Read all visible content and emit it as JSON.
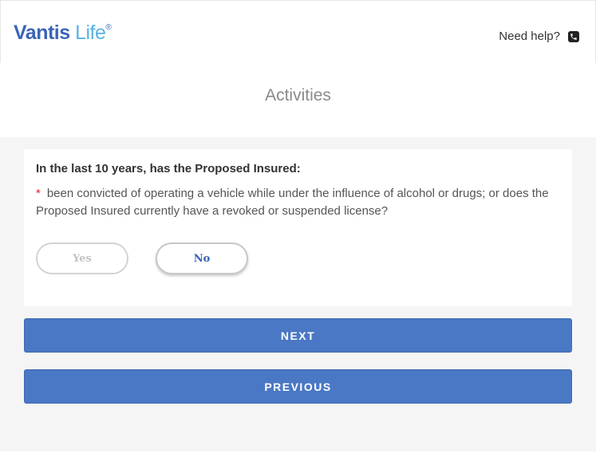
{
  "header": {
    "logo": {
      "part1": "Vantis",
      "part2": " Life",
      "mark": "®"
    },
    "help_label": "Need help?",
    "help_icon": "phone-icon"
  },
  "page_title": "Activities",
  "question": {
    "heading": "In the last 10 years, has the Proposed Insured:",
    "required_marker": "*",
    "text": "been convicted of operating a vehicle while under the influence of alcohol or drugs; or does the Proposed Insured currently have a revoked or suspended license?",
    "options": [
      {
        "label": "Yes",
        "selected": false
      },
      {
        "label": "No",
        "selected": true
      }
    ]
  },
  "buttons": {
    "next": "NEXT",
    "previous": "PREVIOUS"
  },
  "colors": {
    "brand_dark": "#3a64b8",
    "brand_light": "#59b3e6",
    "button": "#4a78c4",
    "background": "#f5f5f5",
    "required": "#d9232e"
  }
}
